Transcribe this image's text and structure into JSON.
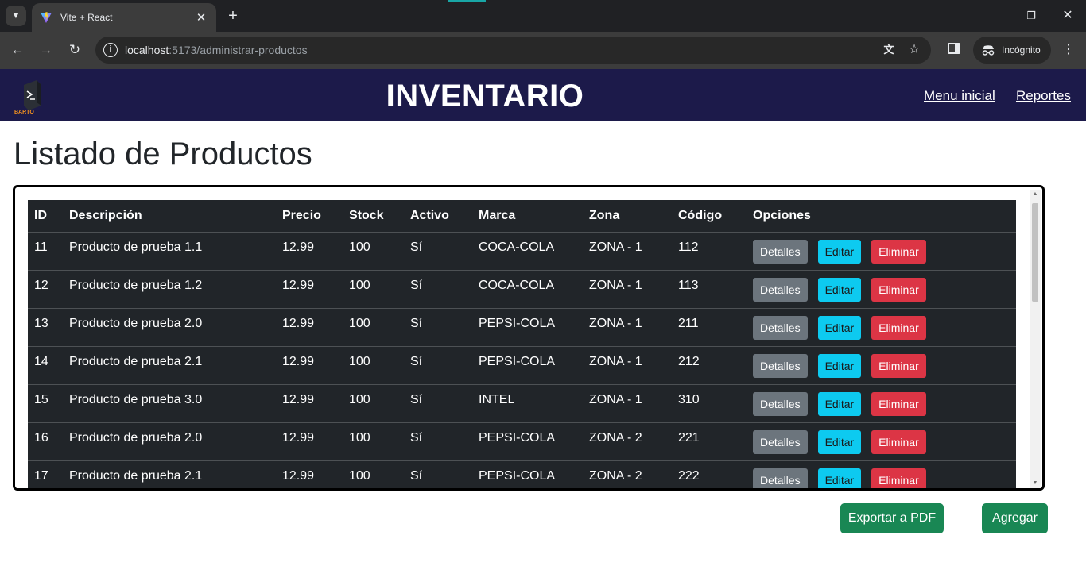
{
  "browser": {
    "tab_title": "Vite + React",
    "url_host": "localhost",
    "url_path": ":5173/administrar-productos",
    "incognito_label": "Incógnito"
  },
  "header": {
    "title": "INVENTARIO",
    "nav": [
      "Menu inicial",
      "Reportes"
    ],
    "logo_text": "BARTO",
    "bg_color": "#1c1a4a"
  },
  "page": {
    "title": "Listado de Productos"
  },
  "table": {
    "columns": [
      "ID",
      "Descripción",
      "Precio",
      "Stock",
      "Activo",
      "Marca",
      "Zona",
      "Código",
      "Opciones"
    ],
    "rows": [
      {
        "id": "11",
        "descripcion": "Producto de prueba 1.1",
        "precio": "12.99",
        "stock": "100",
        "activo": "Sí",
        "marca": "COCA-COLA",
        "zona": "ZONA - 1",
        "codigo": "112"
      },
      {
        "id": "12",
        "descripcion": "Producto de prueba 1.2",
        "precio": "12.99",
        "stock": "100",
        "activo": "Sí",
        "marca": "COCA-COLA",
        "zona": "ZONA - 1",
        "codigo": "113"
      },
      {
        "id": "13",
        "descripcion": "Producto de prueba 2.0",
        "precio": "12.99",
        "stock": "100",
        "activo": "Sí",
        "marca": "PEPSI-COLA",
        "zona": "ZONA - 1",
        "codigo": "211"
      },
      {
        "id": "14",
        "descripcion": "Producto de prueba 2.1",
        "precio": "12.99",
        "stock": "100",
        "activo": "Sí",
        "marca": "PEPSI-COLA",
        "zona": "ZONA - 1",
        "codigo": "212"
      },
      {
        "id": "15",
        "descripcion": "Producto de prueba 3.0",
        "precio": "12.99",
        "stock": "100",
        "activo": "Sí",
        "marca": "INTEL",
        "zona": "ZONA - 1",
        "codigo": "310"
      },
      {
        "id": "16",
        "descripcion": "Producto de prueba 2.0",
        "precio": "12.99",
        "stock": "100",
        "activo": "Sí",
        "marca": "PEPSI-COLA",
        "zona": "ZONA - 2",
        "codigo": "221"
      },
      {
        "id": "17",
        "descripcion": "Producto de prueba 2.1",
        "precio": "12.99",
        "stock": "100",
        "activo": "Sí",
        "marca": "PEPSI-COLA",
        "zona": "ZONA - 2",
        "codigo": "222"
      }
    ],
    "row_actions": {
      "details": "Detalles",
      "edit": "Editar",
      "delete": "Eliminar"
    }
  },
  "actions": {
    "export_pdf": "Exportar a PDF",
    "add": "Agregar"
  },
  "colors": {
    "table_bg": "#212529",
    "btn_secondary": "#6c757d",
    "btn_info": "#0dcaf0",
    "btn_danger": "#dc3545",
    "btn_success": "#198754"
  },
  "icons": [
    "tab-search-icon",
    "vite-favicon-icon",
    "close-icon",
    "new-tab-icon",
    "minimize-icon",
    "restore-icon",
    "window-close-icon",
    "back-icon",
    "forward-icon",
    "reload-icon",
    "site-info-icon",
    "translate-icon",
    "bookmark-star-icon",
    "side-panel-icon",
    "incognito-icon",
    "more-menu-icon"
  ]
}
